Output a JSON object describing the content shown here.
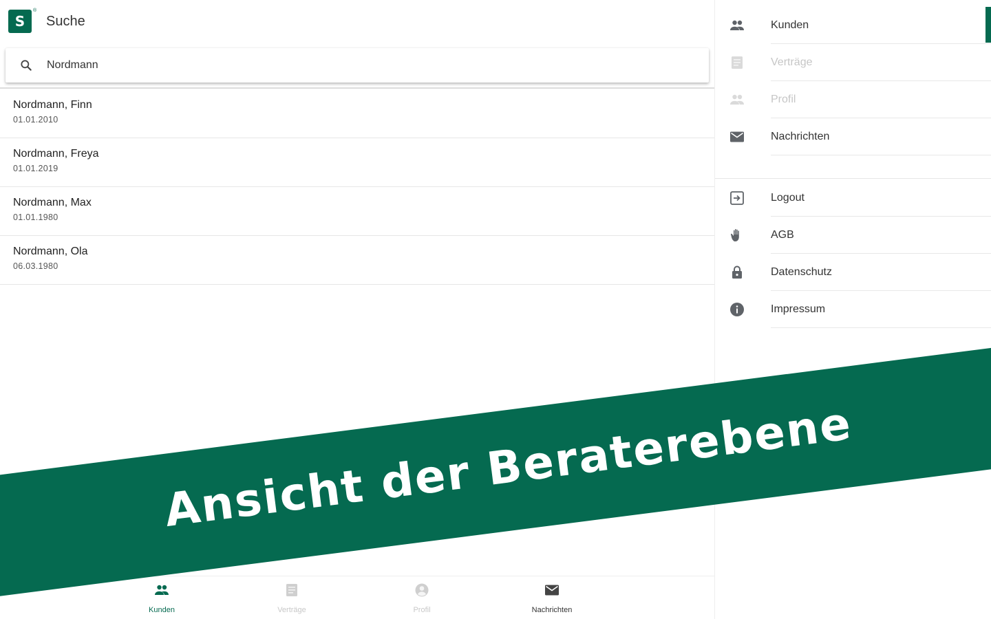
{
  "app": {
    "title": "Suche",
    "logo_mark": "S",
    "logo_registered": "®"
  },
  "search": {
    "value": "Nordmann",
    "placeholder": ""
  },
  "results": [
    {
      "name": "Nordmann, Finn",
      "date": "01.01.2010"
    },
    {
      "name": "Nordmann, Freya",
      "date": "01.01.2019"
    },
    {
      "name": "Nordmann, Max",
      "date": "01.01.1980"
    },
    {
      "name": "Nordmann, Ola",
      "date": "06.03.1980"
    }
  ],
  "bottom_nav": [
    {
      "label": "Kunden",
      "icon": "people-icon",
      "state": "active"
    },
    {
      "label": "Verträge",
      "icon": "document-icon",
      "state": "disabled"
    },
    {
      "label": "Profil",
      "icon": "account-circle-icon",
      "state": "disabled"
    },
    {
      "label": "Nachrichten",
      "icon": "mail-icon",
      "state": "normal"
    }
  ],
  "drawer": {
    "primary": [
      {
        "label": "Kunden",
        "icon": "people-icon",
        "state": "active"
      },
      {
        "label": "Verträge",
        "icon": "document-icon",
        "state": "disabled"
      },
      {
        "label": "Profil",
        "icon": "people-icon",
        "state": "disabled"
      },
      {
        "label": "Nachrichten",
        "icon": "mail-icon",
        "state": "normal"
      }
    ],
    "secondary": [
      {
        "label": "Logout",
        "icon": "logout-icon"
      },
      {
        "label": "AGB",
        "icon": "hand-icon"
      },
      {
        "label": "Datenschutz",
        "icon": "lock-icon"
      },
      {
        "label": "Impressum",
        "icon": "info-icon"
      }
    ]
  },
  "banner": {
    "text": "Ansicht der Beraterebene"
  },
  "colors": {
    "brand": "#056a50",
    "icon": "#5f6368",
    "disabled": "#c8c8c8"
  }
}
